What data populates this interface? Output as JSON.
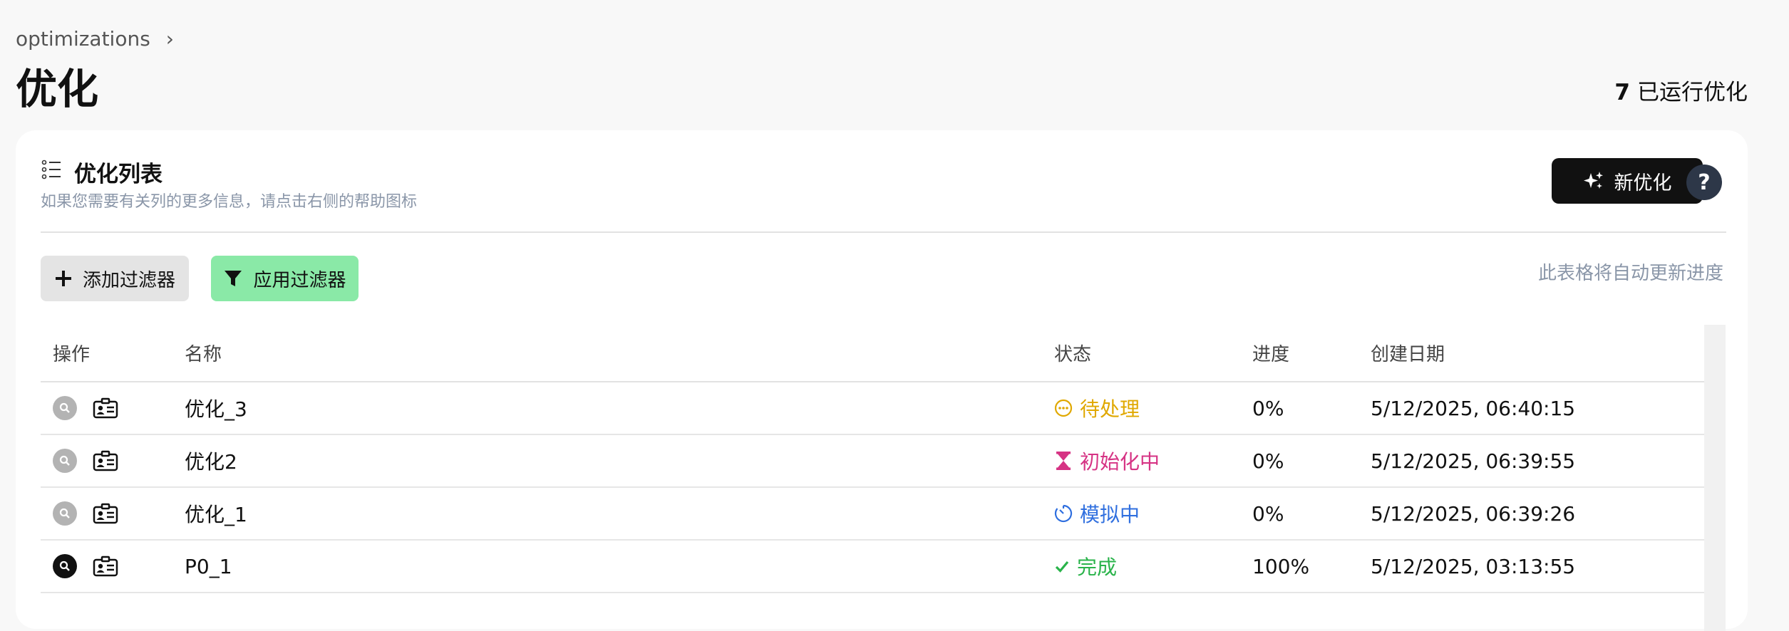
{
  "breadcrumb": {
    "root": "optimizations",
    "separator": ">"
  },
  "page": {
    "title": "优化"
  },
  "run_count": {
    "value": "7",
    "label": "已运行优化"
  },
  "card": {
    "title": "优化列表",
    "subtitle": "如果您需要有关列的更多信息，请点击右侧的帮助图标",
    "new_button": "新优化",
    "help_button": "?",
    "add_filter": "添加过滤器",
    "apply_filter": "应用过滤器",
    "auto_note": "此表格将自动更新进度"
  },
  "table": {
    "columns": {
      "actions": "操作",
      "name": "名称",
      "status": "状态",
      "progress": "进度",
      "created": "创建日期"
    },
    "rows": [
      {
        "name": "优化_3",
        "status": "待处理",
        "progress": "0%",
        "created": "5/12/2025, 06:40:15",
        "status_icon": "pending-dots-icon"
      },
      {
        "name": "优化2",
        "status": "初始化中",
        "progress": "0%",
        "created": "5/12/2025, 06:39:55",
        "status_icon": "hourglass-icon"
      },
      {
        "name": "优化_1",
        "status": "模拟中",
        "progress": "0%",
        "created": "5/12/2025, 06:39:26",
        "status_icon": "timer-icon"
      },
      {
        "name": "P0_1",
        "status": "完成",
        "progress": "100%",
        "created": "5/12/2025, 03:13:55",
        "status_icon": "check-icon"
      }
    ]
  },
  "colors": {
    "pending": "#e0a800",
    "initializing": "#d63384",
    "simulating": "#2f6fdf",
    "done": "#29b34a",
    "apply_filter_bg": "#8ae9a7",
    "primary_button_bg": "#111111"
  }
}
